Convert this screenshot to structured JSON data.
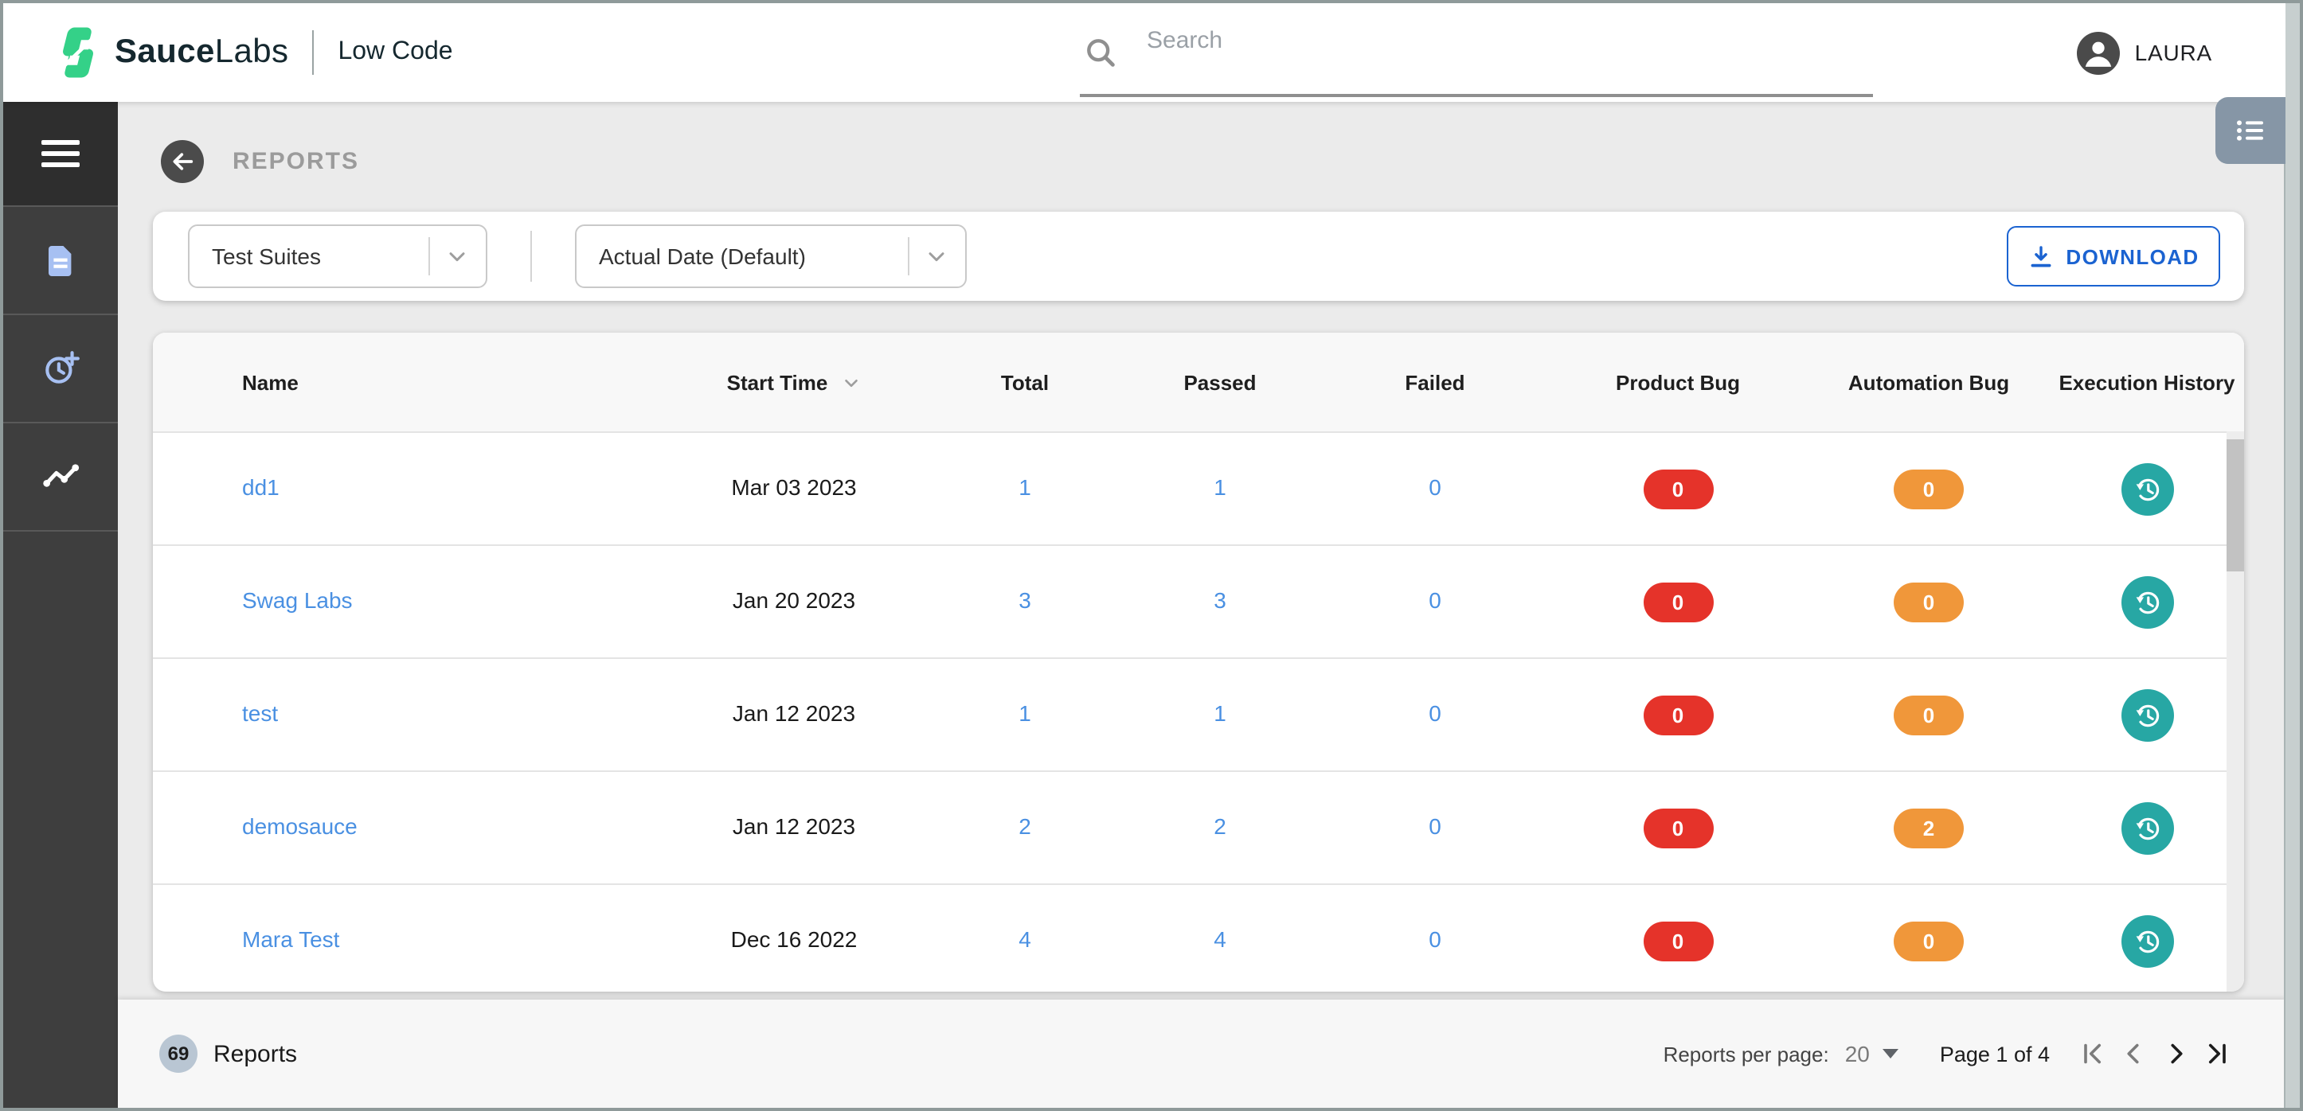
{
  "topbar": {
    "brand": {
      "name_bold": "Sauce",
      "name_regular": "Labs",
      "product": "Low Code"
    },
    "search": {
      "placeholder": "Search"
    },
    "user": {
      "name": "LAURA"
    }
  },
  "sidebar": {
    "items": [
      {
        "id": "menu",
        "icon": "hamburger-icon"
      },
      {
        "id": "reports",
        "icon": "document-icon"
      },
      {
        "id": "schedules",
        "icon": "clock-plus-icon"
      },
      {
        "id": "insights",
        "icon": "trend-icon",
        "active": true
      }
    ]
  },
  "page": {
    "title": "REPORTS"
  },
  "filters": {
    "suite": {
      "value": "Test Suites"
    },
    "date": {
      "value": "Actual Date (Default)"
    },
    "download_label": "DOWNLOAD"
  },
  "table": {
    "columns": [
      "Name",
      "Start Time",
      "Total",
      "Passed",
      "Failed",
      "Product Bug",
      "Automation Bug",
      "Execution History"
    ],
    "rows": [
      {
        "name": "dd1",
        "start_time": "Mar 03 2023",
        "total": "1",
        "passed": "1",
        "failed": "0",
        "product_bug": "0",
        "automation_bug": "0"
      },
      {
        "name": "Swag Labs",
        "start_time": "Jan 20 2023",
        "total": "3",
        "passed": "3",
        "failed": "0",
        "product_bug": "0",
        "automation_bug": "0"
      },
      {
        "name": "test",
        "start_time": "Jan 12 2023",
        "total": "1",
        "passed": "1",
        "failed": "0",
        "product_bug": "0",
        "automation_bug": "0"
      },
      {
        "name": "demosauce",
        "start_time": "Jan 12 2023",
        "total": "2",
        "passed": "2",
        "failed": "0",
        "product_bug": "0",
        "automation_bug": "2"
      },
      {
        "name": "Mara Test",
        "start_time": "Dec 16 2022",
        "total": "4",
        "passed": "4",
        "failed": "0",
        "product_bug": "0",
        "automation_bug": "0"
      }
    ]
  },
  "footer": {
    "count": "69",
    "count_label": "Reports",
    "per_page_label": "Reports per page:",
    "per_page_value": "20",
    "page_status": "Page 1 of 4"
  },
  "colors": {
    "brand_green": "#34d188",
    "link_blue": "#4a90e2",
    "download_blue": "#1b63d1",
    "product_bug_red": "#e5332a",
    "automation_bug_orange": "#f0973a",
    "history_teal": "#27a7a4",
    "slate_button": "#8696a6",
    "sidebar_icon_blue": "#a7c0f2"
  }
}
